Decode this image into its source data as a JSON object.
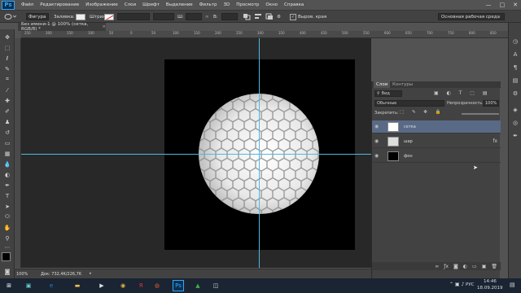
{
  "menu": {
    "logo": "Ps",
    "items": [
      "Файл",
      "Редактирование",
      "Изображение",
      "Слои",
      "Шрифт",
      "Выделение",
      "Фильтр",
      "3D",
      "Просмотр",
      "Окно",
      "Справка"
    ],
    "win_min": "—",
    "win_max": "□",
    "win_close": "✕"
  },
  "options": {
    "shape_mode": "Фигура",
    "fill_label": "Заливка:",
    "stroke_label": "Штрих:",
    "w_label": "Ш:",
    "h_label": "В:",
    "align_edges_label": "Выров. края",
    "workspace": "Основная рабочая среда"
  },
  "document": {
    "tab_title": "Без имени-1 @ 100% (сетка, RGB/8) *",
    "zoom": "100%",
    "doc_info": "Док: 732,4K/226,7K"
  },
  "ruler": {
    "top_ticks": [
      "250",
      "200",
      "150",
      "100",
      "50",
      "0",
      "50",
      "100",
      "150",
      "200",
      "250",
      "300",
      "350",
      "400",
      "450",
      "500",
      "550",
      "600",
      "650",
      "700",
      "750",
      "800",
      "850"
    ]
  },
  "layers_panel": {
    "tab_layers": "Слои",
    "tab_contours": "Контуры",
    "filter_kind": "Вид",
    "blend_mode": "Обычные",
    "opacity_label": "Непрозрачность:",
    "opacity_value": "100%",
    "lock_label": "Закрепить:",
    "fill_label": "Заливка:",
    "fill_value": "100%",
    "layers": [
      {
        "name": "сетка"
      },
      {
        "name": "шар"
      },
      {
        "name": "фон"
      }
    ],
    "fx_badge": "fx"
  },
  "taskbar": {
    "lang": "РУС",
    "time": "14:46",
    "date": "18.09.2019"
  },
  "colors": {
    "accent": "#31a8ff",
    "guide": "#4fb8e0",
    "selected_layer": "#596a86"
  }
}
